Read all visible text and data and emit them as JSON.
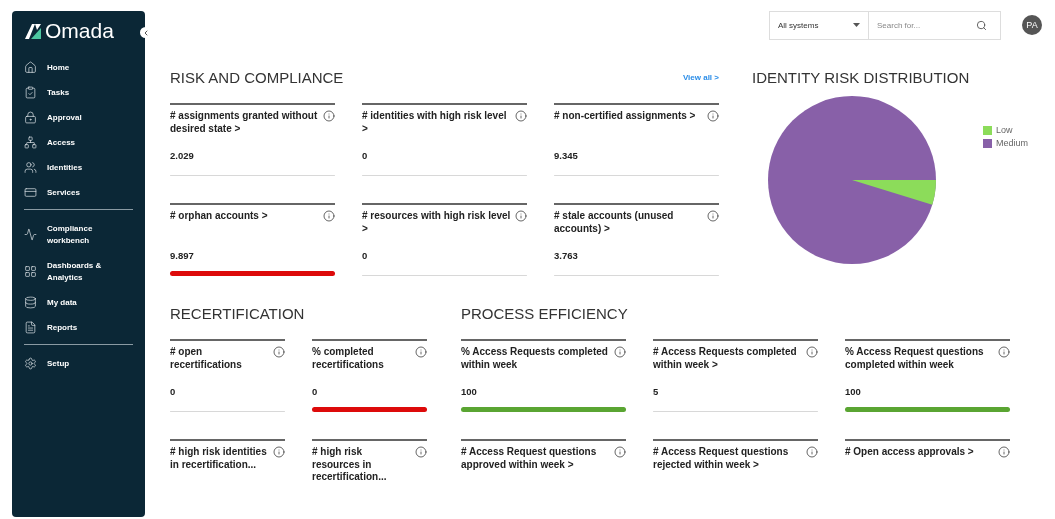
{
  "sidebar": {
    "logo": "Omada",
    "items": [
      {
        "label": "Home"
      },
      {
        "label": "Tasks"
      },
      {
        "label": "Approval"
      },
      {
        "label": "Access"
      },
      {
        "label": "Identities"
      },
      {
        "label": "Services"
      },
      {
        "label": "Compliance workbench"
      },
      {
        "label": "Dashboards & Analytics"
      },
      {
        "label": "My data"
      },
      {
        "label": "Reports"
      },
      {
        "label": "Setup"
      }
    ]
  },
  "header": {
    "system_select": "All systems",
    "search": {
      "placeholder": "Search for..."
    },
    "avatar": "PA"
  },
  "risk_and_compliance": {
    "title": "RISK AND COMPLIANCE",
    "view_all": "View all >",
    "cards": [
      {
        "title": "# assignments granted without desired state >",
        "value": "2.029"
      },
      {
        "title": "# identities with high risk level >",
        "value": "0"
      },
      {
        "title": "# non-certified assignments >",
        "value": "9.345"
      },
      {
        "title": "# orphan accounts >",
        "value": "9.897",
        "color": "#dd0a0a"
      },
      {
        "title": "# resources with high risk level >",
        "value": "0"
      },
      {
        "title": "# stale accounts (unused accounts) >",
        "value": "3.763"
      }
    ]
  },
  "identity_risk_distribution": {
    "title": "IDENTITY RISK DISTRIBUTION",
    "legend": [
      {
        "label": "Low",
        "color": "#8cdc5a"
      },
      {
        "label": "Medium",
        "color": "#8860a8"
      }
    ]
  },
  "recertification": {
    "title": "RECERTIFICATION",
    "cards": [
      {
        "title": "# open recertifications",
        "value": "0"
      },
      {
        "title": "% completed recertifications",
        "value": "0",
        "color": "#dd0a0a"
      },
      {
        "title": "# high risk identities in recertification..."
      },
      {
        "title": "# high risk resources in recertification..."
      }
    ]
  },
  "process_efficiency": {
    "title": "PROCESS EFFICIENCY",
    "cards": [
      {
        "title": "% Access Requests completed within week",
        "value": "100",
        "color": "#5aa532"
      },
      {
        "title": "# Access Requests completed within week >",
        "value": "5"
      },
      {
        "title": "% Access Request questions completed within week",
        "value": "100",
        "color": "#5aa532"
      },
      {
        "title": "# Access Request questions approved within week >"
      },
      {
        "title": "# Access Request questions rejected within week >"
      },
      {
        "title": "# Open access approvals >"
      }
    ]
  }
}
